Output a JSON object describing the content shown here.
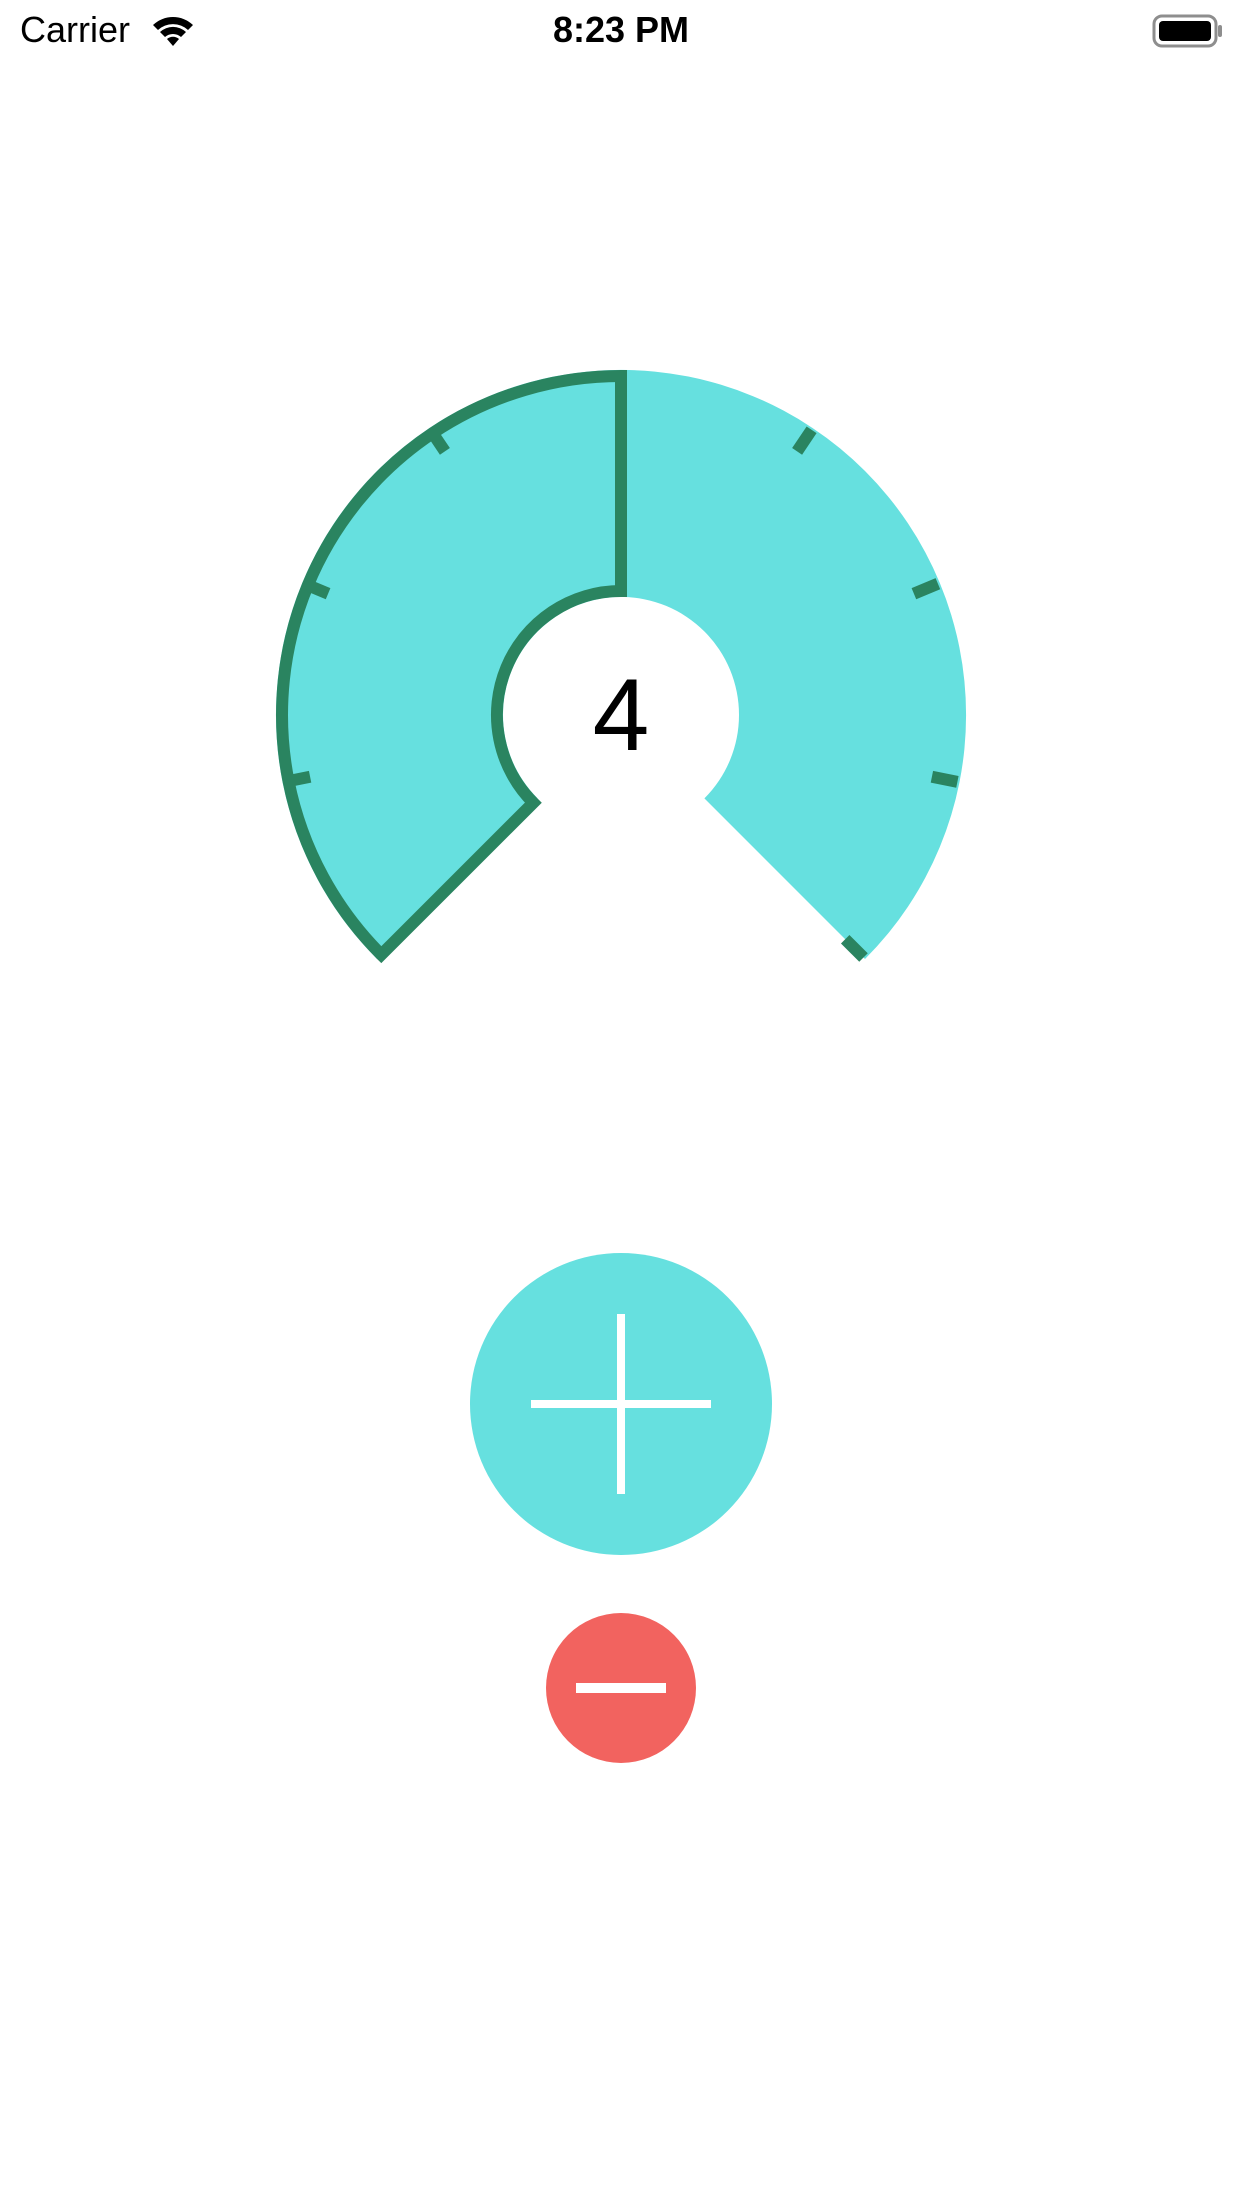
{
  "status_bar": {
    "carrier": "Carrier",
    "time": "8:23 PM",
    "wifi_icon": "wifi-icon",
    "battery_icon": "battery-icon"
  },
  "gauge": {
    "value": "4",
    "level": 4,
    "segments": 8,
    "fill_color": "#66E0DF",
    "outline_color": "#2A8460"
  },
  "controls": {
    "increment_icon": "plus-icon",
    "increment_color": "#66E0DF",
    "decrement_icon": "minus-icon",
    "decrement_color": "#F2635F"
  }
}
